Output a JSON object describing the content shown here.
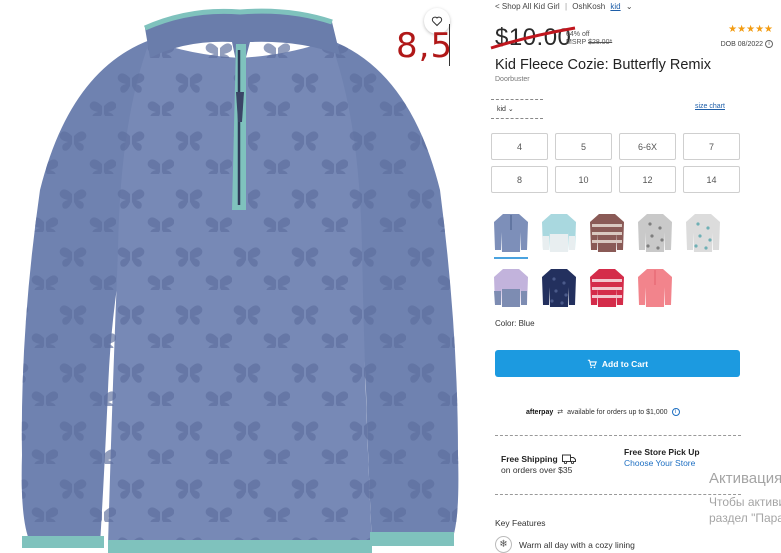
{
  "product_image": {
    "alt": "Blue butterfly print half-zip fleece pullover"
  },
  "overlay_note": "8,5",
  "breadcrumb": {
    "back": "< Shop All Kid Girl",
    "sep": "|",
    "brand": "OshKosh",
    "filter": "kid"
  },
  "price": {
    "current": "$10.00",
    "discount": "64% off",
    "msrp_label": "MSRP",
    "msrp": "$28.00*"
  },
  "rating": {
    "stars": "★★★★★",
    "dob": "DOB 08/2022"
  },
  "title": "Kid Fleece Cozie: Butterfly Remix",
  "subtitle": "Doorbuster",
  "size_select": {
    "value": "kid"
  },
  "size_chart": "size chart",
  "sizes": [
    "4",
    "5",
    "6-6X",
    "7",
    "8",
    "10",
    "12",
    "14"
  ],
  "swatches": [
    {
      "name": "blue",
      "colors": [
        "#7d8fb9",
        "#5a6d99"
      ],
      "pattern": "solid"
    },
    {
      "name": "aqua-colorblock",
      "colors": [
        "#a9d8df",
        "#e8eef0"
      ],
      "pattern": "block"
    },
    {
      "name": "fair-isle-brown",
      "colors": [
        "#8a5a56",
        "#d9c8c0"
      ],
      "pattern": "stripes"
    },
    {
      "name": "gray-print",
      "colors": [
        "#c9c9c9",
        "#7e7e7e"
      ],
      "pattern": "dots"
    },
    {
      "name": "floral-gray",
      "colors": [
        "#dcdcdc",
        "#6fb0b5"
      ],
      "pattern": "dots"
    },
    {
      "name": "lavender-colorblock",
      "colors": [
        "#c2b3dc",
        "#7d8cb2"
      ],
      "pattern": "block"
    },
    {
      "name": "navy-print",
      "colors": [
        "#23305e",
        "#4b5a8a"
      ],
      "pattern": "dots"
    },
    {
      "name": "red-fair-isle",
      "colors": [
        "#d42c4a",
        "#f1c7cf"
      ],
      "pattern": "stripes"
    },
    {
      "name": "pink",
      "colors": [
        "#f2848c",
        "#e96c77"
      ],
      "pattern": "solid"
    }
  ],
  "color_label": "Color: Blue",
  "add_to_cart": "Add to Cart",
  "afterpay": {
    "brand": "afterpay",
    "text": "available for orders up to $1,000"
  },
  "shipping": {
    "title": "Free Shipping",
    "sub": "on orders over $35"
  },
  "pickup": {
    "title": "Free Store Pick Up",
    "link": "Choose Your Store"
  },
  "key_features": {
    "heading": "Key Features",
    "first": "Warm all day with a cozy lining"
  },
  "activation": {
    "line1": "Активация Windows",
    "line2": "Чтобы активировать Windows, перейдите в",
    "line3": "раздел \"Параметры\"."
  },
  "colors": {
    "accent": "#1c9ae0",
    "link": "#1e5ea8",
    "star": "#f39c12",
    "strike": "#c0161e"
  }
}
